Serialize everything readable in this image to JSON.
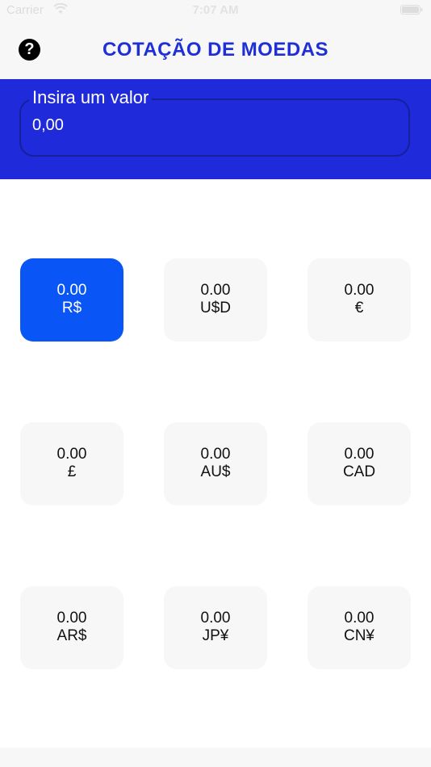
{
  "status_bar": {
    "carrier": "Carrier",
    "time": "7:07 AM"
  },
  "header": {
    "title": "COTAÇÃO DE MOEDAS",
    "help_icon": "help-icon",
    "help_label": "?"
  },
  "amount_input": {
    "label": "Insira um valor",
    "value": "0,00"
  },
  "currencies": [
    {
      "value": "0.00",
      "code": "R$",
      "selected": true
    },
    {
      "value": "0.00",
      "code": "U$D",
      "selected": false
    },
    {
      "value": "0.00",
      "code": "€",
      "selected": false
    },
    {
      "value": "0.00",
      "code": "£",
      "selected": false
    },
    {
      "value": "0.00",
      "code": "AU$",
      "selected": false
    },
    {
      "value": "0.00",
      "code": "CAD",
      "selected": false
    },
    {
      "value": "0.00",
      "code": "AR$",
      "selected": false
    },
    {
      "value": "0.00",
      "code": "JP¥",
      "selected": false
    },
    {
      "value": "0.00",
      "code": "CN¥",
      "selected": false
    }
  ],
  "colors": {
    "accent_blue": "#1f2bdb",
    "title_blue": "#1f2fd8",
    "selected_card": "#0a55f5",
    "card_bg": "#f7f7f7"
  }
}
